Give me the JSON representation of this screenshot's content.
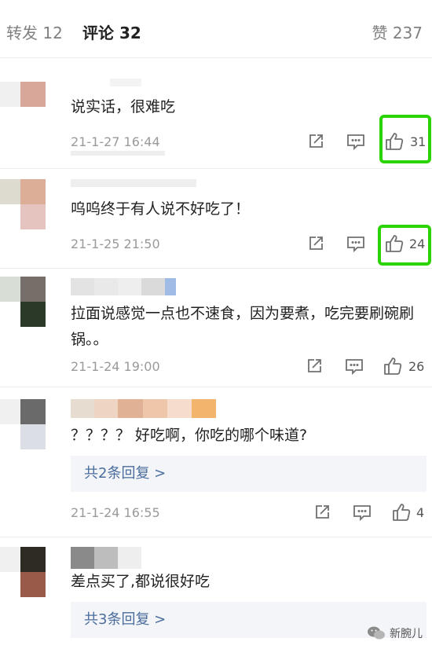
{
  "tabs": {
    "repost": "转发 12",
    "comments": "评论 32",
    "likes": "赞 237"
  },
  "comments": [
    {
      "text": "说实话，很难吃",
      "time": "21-1-27 16:44",
      "likes": "31",
      "highlighted": true
    },
    {
      "text": "呜呜终于有人说不好吃了！",
      "time": "21-1-25 21:50",
      "likes": "24",
      "highlighted": true
    },
    {
      "text": "拉面说感觉一点也不速食，因为要煮，吃完要刷碗刷锅。。",
      "time": "21-1-24 19:00",
      "likes": "26",
      "highlighted": false
    },
    {
      "text": "？？？？ 好吃啊，你吃的哪个味道?",
      "time": "21-1-24 16:55",
      "likes": "4",
      "replies": "共2条回复 >",
      "highlighted": false
    },
    {
      "text": "差点买了,都说很好吃",
      "replies": "共3条回复 >",
      "highlighted": false
    }
  ],
  "watermark": {
    "label": "新腕儿"
  },
  "colors": {
    "highlight": "#2bd400",
    "link": "#4a6d9d",
    "muted": "#9a9a9a"
  }
}
